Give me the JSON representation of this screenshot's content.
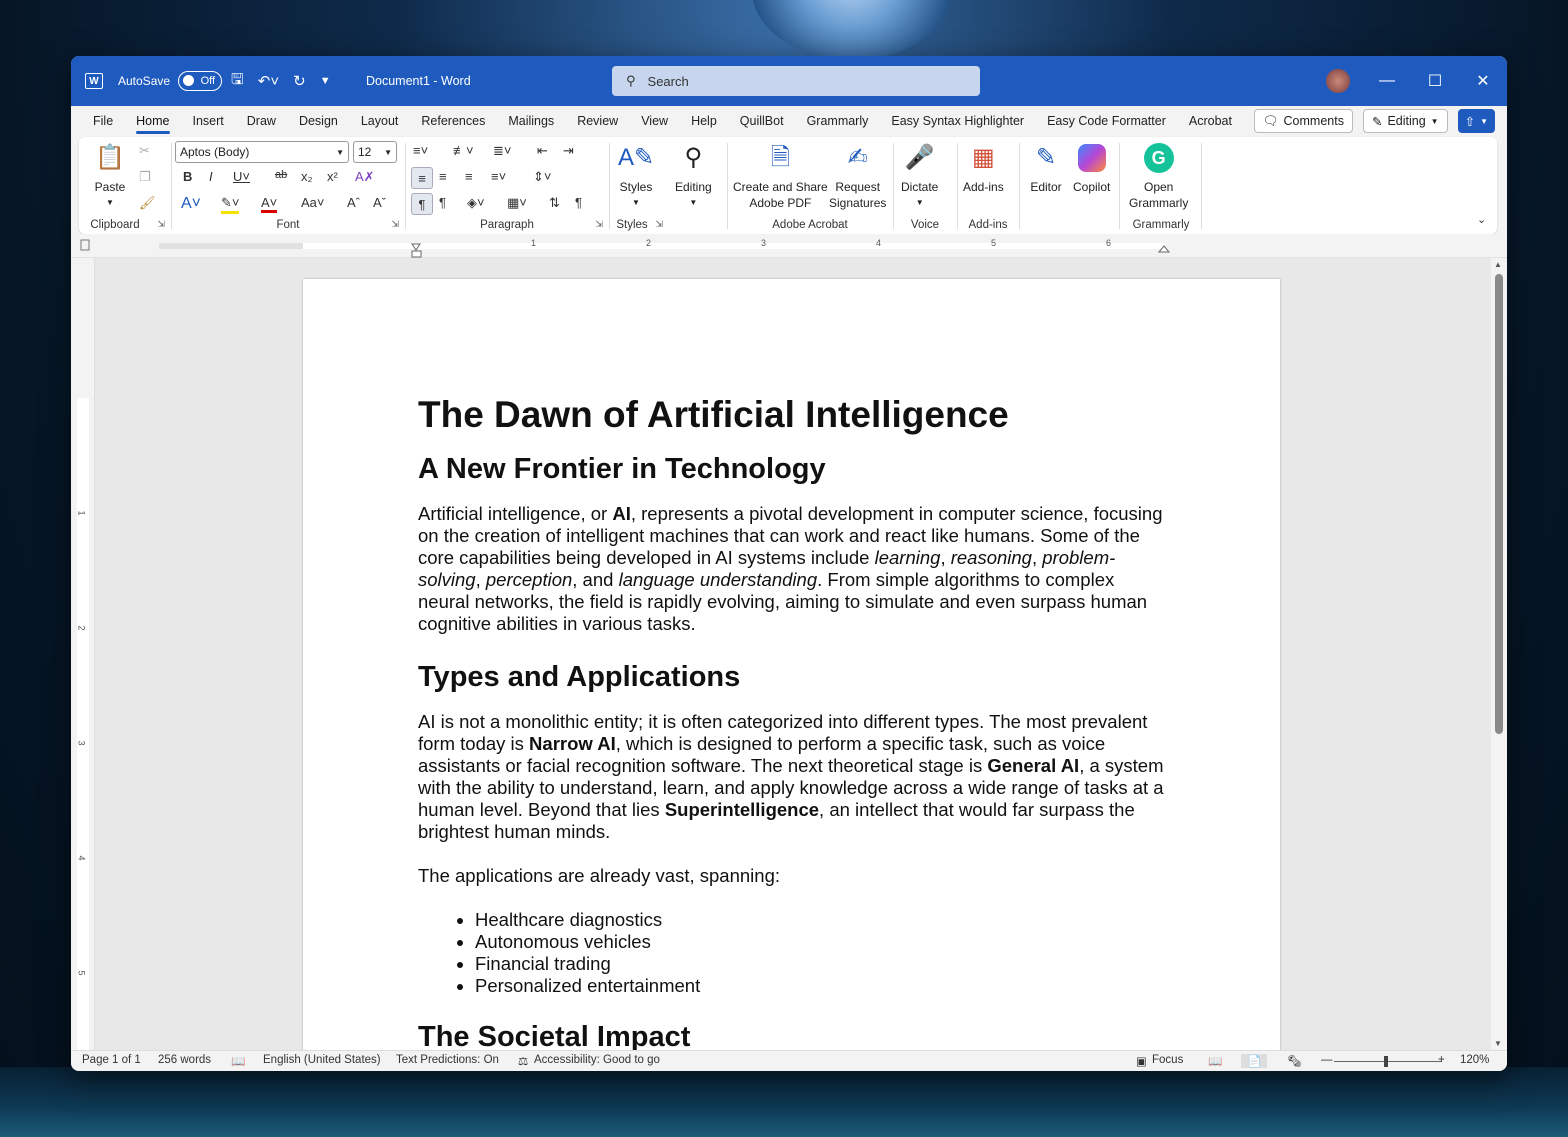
{
  "titlebar": {
    "autosave_label": "AutoSave",
    "autosave_state": "Off",
    "document_title": "Document1 - Word",
    "search_placeholder": "Search"
  },
  "tabs": [
    "File",
    "Home",
    "Insert",
    "Draw",
    "Design",
    "Layout",
    "References",
    "Mailings",
    "Review",
    "View",
    "Help",
    "QuillBot",
    "Grammarly",
    "Easy Syntax Highlighter",
    "Easy Code Formatter",
    "Acrobat"
  ],
  "active_tab": "Home",
  "tab_right": {
    "comments": "Comments",
    "editing": "Editing"
  },
  "ribbon": {
    "clipboard": {
      "label": "Clipboard",
      "paste": "Paste"
    },
    "font": {
      "label": "Font",
      "font_name": "Aptos (Body)",
      "font_size": "12"
    },
    "paragraph": {
      "label": "Paragraph"
    },
    "styles": {
      "label": "Styles",
      "styles_btn": "Styles"
    },
    "editing": {
      "editing_btn": "Editing"
    },
    "adobe": {
      "label": "Adobe Acrobat",
      "create_share_1": "Create and Share",
      "create_share_2": "Adobe PDF",
      "request_1": "Request",
      "request_2": "Signatures"
    },
    "voice": {
      "label": "Voice",
      "dictate": "Dictate"
    },
    "addins": {
      "label": "Add-ins",
      "addins_btn": "Add-ins"
    },
    "editor": "Editor",
    "copilot": "Copilot",
    "grammarly": {
      "label": "Grammarly",
      "open_1": "Open",
      "open_2": "Grammarly"
    }
  },
  "ruler": [
    "1",
    "2",
    "3",
    "4",
    "5",
    "6"
  ],
  "vruler": [
    "1",
    "2",
    "3",
    "4",
    "5"
  ],
  "document": {
    "title": "The Dawn of Artificial Intelligence",
    "h2_1": "A New Frontier in Technology",
    "p1": {
      "a": "Artificial intelligence, or ",
      "b": "AI",
      "c": ", represents a pivotal development in computer science, focusing on the creation of intelligent machines that can work and react like humans. Some of the core capabilities being developed in AI systems include ",
      "i1": "learning",
      "s1": ", ",
      "i2": "reasoning",
      "s2": ", ",
      "i3": "problem-solving",
      "s3": ", ",
      "i4": "perception",
      "s4": ", and ",
      "i5": "language understanding",
      "d": ". From simple algorithms to complex neural networks, the field is rapidly evolving, aiming to simulate and even surpass human cognitive abilities in various tasks."
    },
    "h2_2": "Types and Applications",
    "p2": {
      "a": "AI is not a monolithic entity; it is often categorized into different types. The most prevalent form today is ",
      "b1": "Narrow AI",
      "c": ", which is designed to perform a specific task, such as voice assistants or facial recognition software. The next theoretical stage is ",
      "b2": "General AI",
      "d": ", a system with the ability to understand, learn, and apply knowledge across a wide range of tasks at a human level. Beyond that lies ",
      "b3": "Superintelligence",
      "e": ", an intellect that would far surpass the brightest human minds."
    },
    "p3": "The applications are already vast, spanning:",
    "list": [
      "Healthcare diagnostics",
      "Autonomous vehicles",
      "Financial trading",
      "Personalized entertainment"
    ],
    "h2_3": "The Societal Impact"
  },
  "status": {
    "page": "Page 1 of 1",
    "words": "256 words",
    "language": "English (United States)",
    "predictions": "Text Predictions: On",
    "accessibility": "Accessibility: Good to go",
    "focus": "Focus",
    "zoom": "120%"
  }
}
